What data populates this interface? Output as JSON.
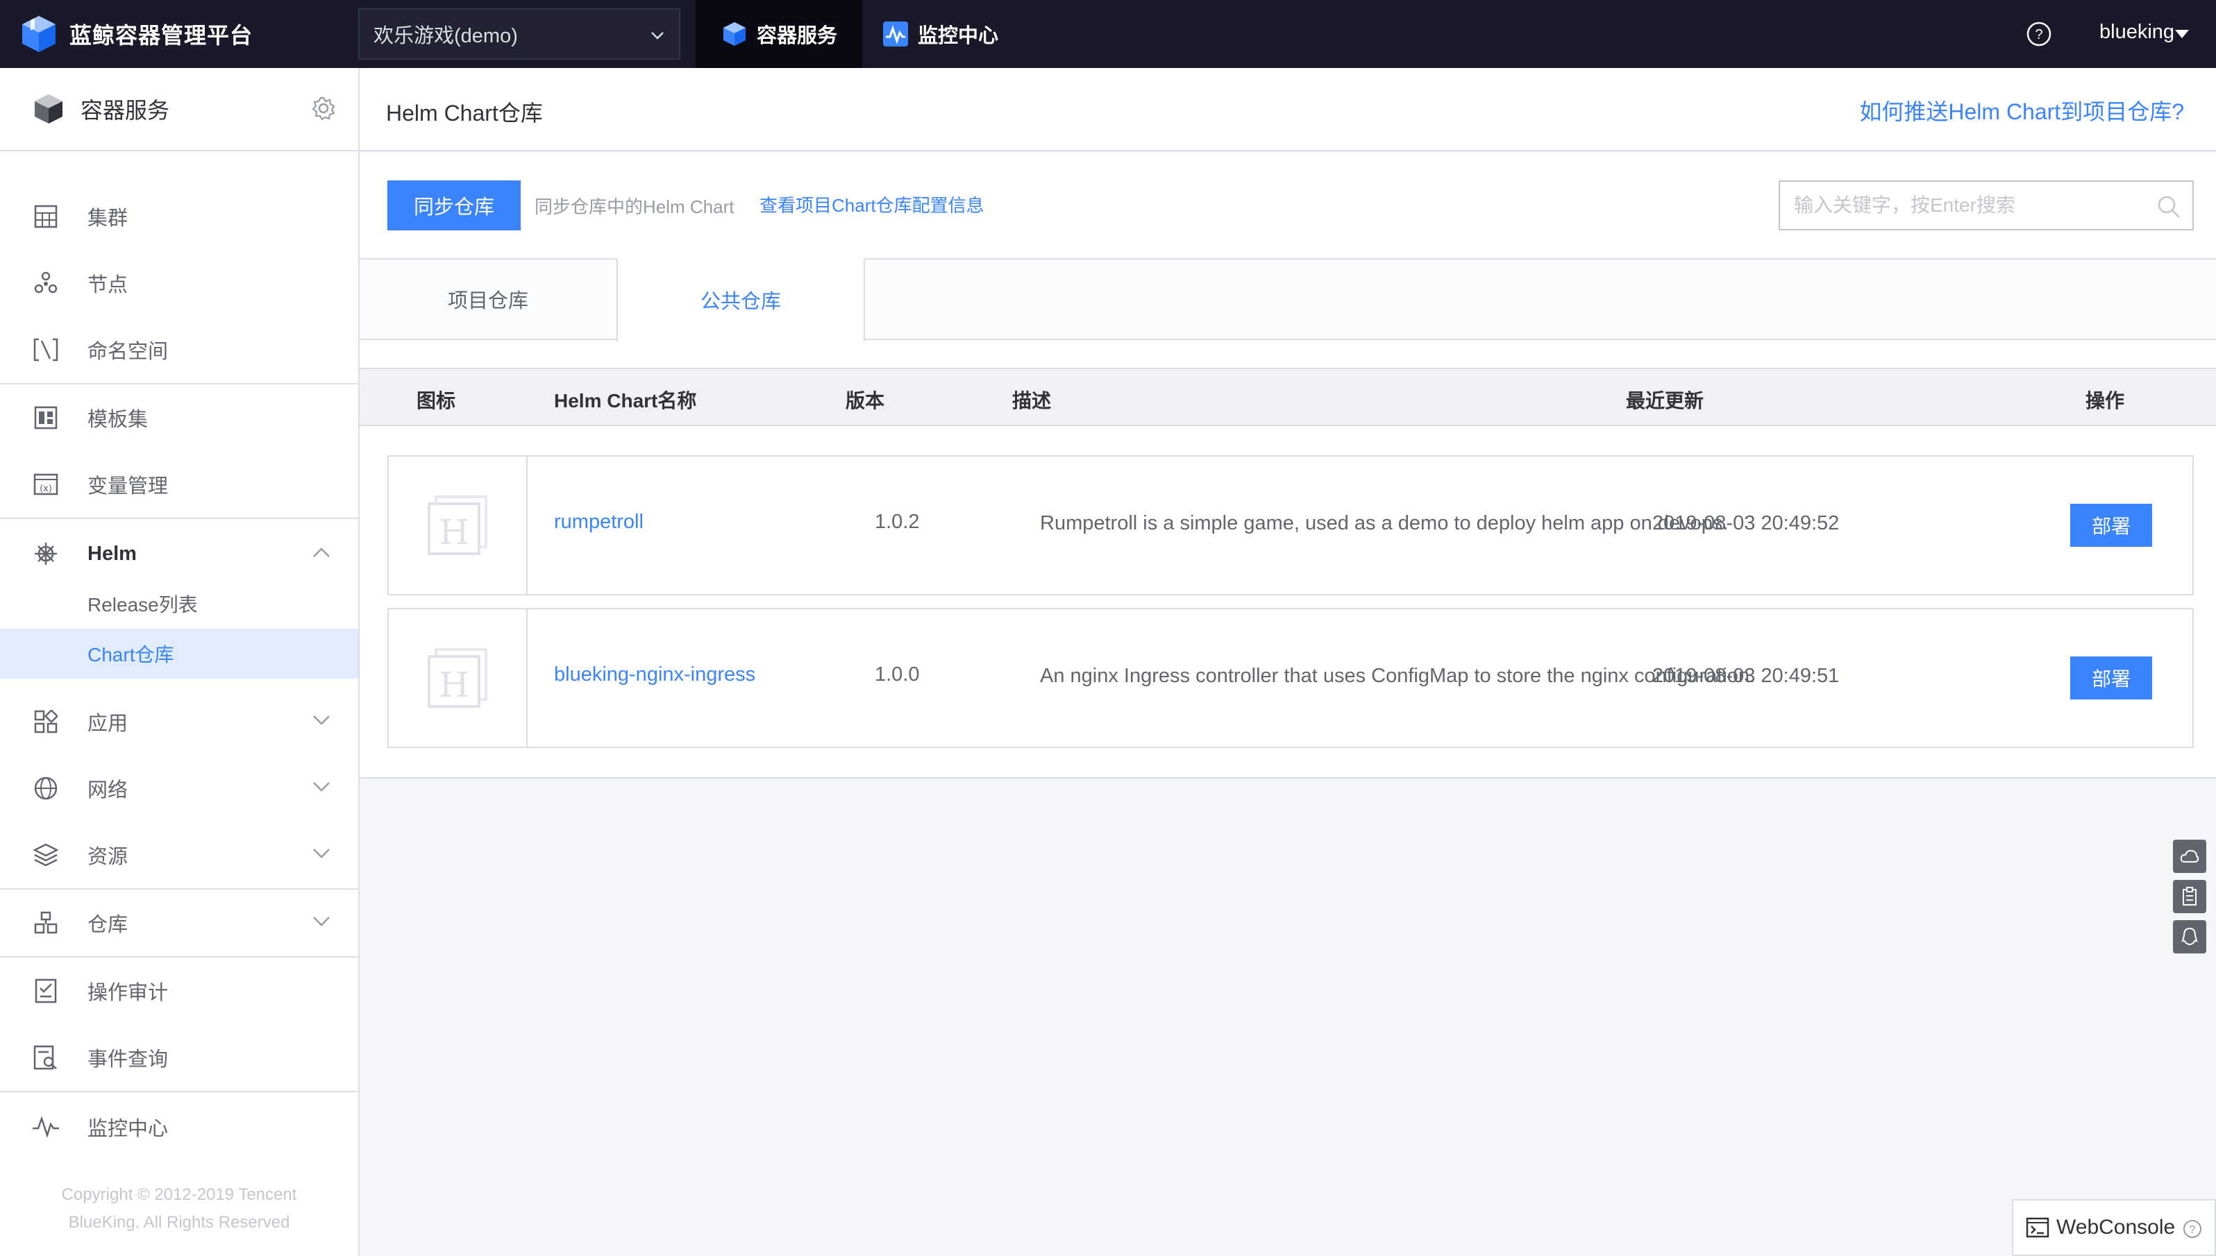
{
  "topbar": {
    "app_name": "蓝鲸容器管理平台",
    "project": "欢乐游戏(demo)",
    "nav": [
      {
        "label": "容器服务",
        "active": true
      },
      {
        "label": "监控中心",
        "active": false
      }
    ],
    "user": "blueking"
  },
  "sidebar": {
    "header": "容器服务",
    "items": [
      {
        "label": "集群",
        "icon": "cluster-icon"
      },
      {
        "label": "节点",
        "icon": "node-icon"
      },
      {
        "label": "命名空间",
        "icon": "namespace-icon"
      },
      {
        "label": "模板集",
        "icon": "template-icon"
      },
      {
        "label": "变量管理",
        "icon": "variable-icon"
      },
      {
        "label": "Helm",
        "icon": "helm-icon",
        "expanded": true
      },
      {
        "label": "应用",
        "icon": "app-icon"
      },
      {
        "label": "网络",
        "icon": "network-icon"
      },
      {
        "label": "资源",
        "icon": "resource-icon"
      },
      {
        "label": "仓库",
        "icon": "repository-icon"
      },
      {
        "label": "操作审计",
        "icon": "audit-icon"
      },
      {
        "label": "事件查询",
        "icon": "event-icon"
      },
      {
        "label": "监控中心",
        "icon": "monitor-icon"
      }
    ],
    "helm_sub": [
      {
        "label": "Release列表",
        "active": false
      },
      {
        "label": "Chart仓库",
        "active": true
      }
    ],
    "copyright_line1": "Copyright © 2012-2019 Tencent",
    "copyright_line2": "BlueKing. All Rights Reserved"
  },
  "main": {
    "title": "Helm Chart仓库",
    "help_link": "如何推送Helm Chart到项目仓库?",
    "sync_button": "同步仓库",
    "sync_hint": "同步仓库中的Helm Chart",
    "config_link": "查看项目Chart仓库配置信息",
    "search_placeholder": "输入关键字，按Enter搜索",
    "tabs": [
      {
        "label": "项目仓库",
        "active": false
      },
      {
        "label": "公共仓库",
        "active": true
      }
    ],
    "columns": [
      "图标",
      "Helm Chart名称",
      "版本",
      "描述",
      "最近更新",
      "操作"
    ],
    "rows": [
      {
        "name": "rumpetroll",
        "version": "1.0.2",
        "description": "Rumpetroll is a simple game, used as a demo to deploy helm app on devops.",
        "updated": "2019-08-03 20:49:52",
        "action": "部署"
      },
      {
        "name": "blueking-nginx-ingress",
        "version": "1.0.0",
        "description": "An nginx Ingress controller that uses ConfigMap to store the nginx configuration.",
        "updated": "2019-08-03 20:49:51",
        "action": "部署"
      }
    ]
  },
  "webconsole": "WebConsole",
  "colors": {
    "accent": "#3a84ff",
    "topbar": "#191929",
    "sidebar_active": "#e1ecff"
  }
}
